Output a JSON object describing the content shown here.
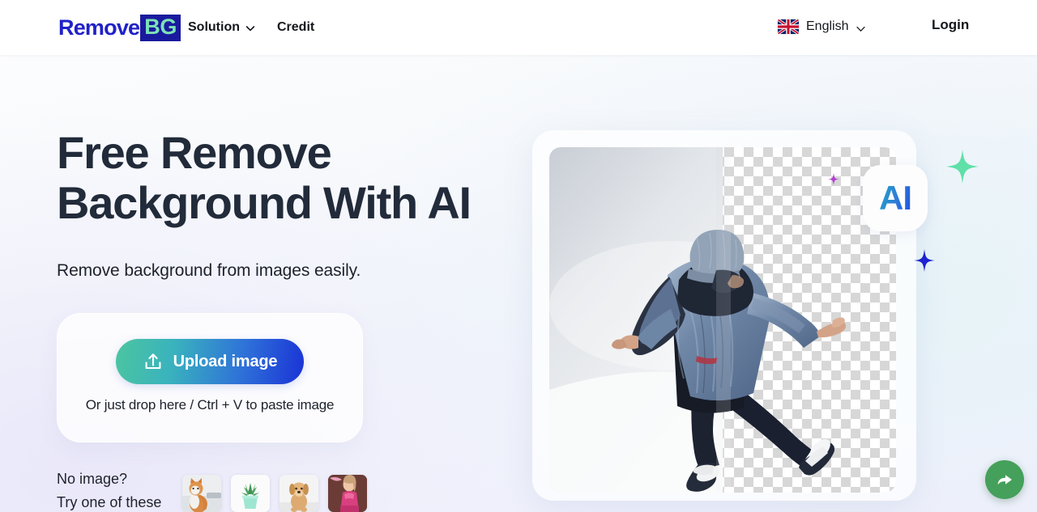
{
  "header": {
    "logo": {
      "part1": "Remove",
      "part2": "BG"
    },
    "nav": [
      {
        "label": "Solution",
        "has_caret": true,
        "icon": "chevron-down-icon"
      },
      {
        "label": "Credit",
        "has_caret": false
      }
    ],
    "language": {
      "label": "English",
      "flag": "uk-flag-icon",
      "icon": "chevron-down-icon"
    },
    "login_label": "Login"
  },
  "hero": {
    "headline": "Free Remove Background With AI",
    "subtitle": "Remove background from images easily.",
    "badge_label": "AI",
    "image_alt": "man-jumping-denim-jacket",
    "sparkles": [
      {
        "name": "sparkle-green",
        "color": "#5fe0a8"
      },
      {
        "name": "sparkle-blue",
        "color": "#1f22cf"
      },
      {
        "name": "sparkle-magenta",
        "color": "#b53fd4"
      }
    ]
  },
  "upload": {
    "button_label": "Upload image",
    "button_icon": "upload-icon",
    "drop_hint": "Or just drop here / Ctrl + V to paste image"
  },
  "samples": {
    "line1": "No image?",
    "line2": "Try one of these",
    "items": [
      {
        "name": "sample-cat",
        "alt": "orange and white cat"
      },
      {
        "name": "sample-plant",
        "alt": "succulent in mint pot"
      },
      {
        "name": "sample-dog",
        "alt": "golden puppy"
      },
      {
        "name": "sample-girl",
        "alt": "girl in pink top"
      }
    ]
  },
  "floating": {
    "share_button": {
      "name": "share-button",
      "icon": "share-arrow-icon",
      "color": "#44a05a"
    }
  },
  "colors": {
    "brand_blue": "#2121c9",
    "brand_mint": "#7de2b8",
    "gradient_start": "#4cc5a0",
    "gradient_end": "#1a32d6",
    "heading": "#222b3a"
  }
}
